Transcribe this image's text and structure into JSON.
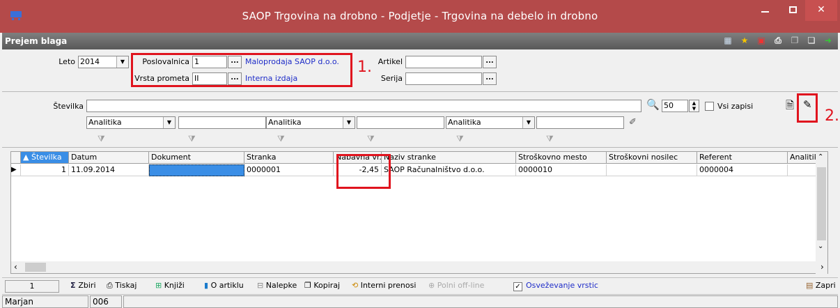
{
  "window": {
    "title": "SAOP Trgovina na drobno - Podjetje - Trgovina na debelo in drobno",
    "minimize": "—",
    "close": "✕"
  },
  "form": {
    "title": "Prejem blaga"
  },
  "filters": {
    "leto_label": "Leto",
    "leto_value": "2014",
    "poslovalnica_label": "Poslovalnica",
    "poslovalnica_value": "1",
    "poslovalnica_name": "Maloprodaja SAOP d.o.o.",
    "vrsta_label": "Vrsta prometa",
    "vrsta_value": "II",
    "vrsta_name": "Interna izdaja",
    "artikel_label": "Artikel",
    "serija_label": "Serija",
    "annotation_1": "1.",
    "annotation_2": "2.",
    "stevilka_label": "Številka",
    "count_value": "50",
    "vsi_zapisi": "Vsi zapisi",
    "analitika_1": "Analitika",
    "analitika_2": "Analitika",
    "analitika_3": "Analitika"
  },
  "grid": {
    "columns": [
      "Številka",
      "Datum",
      "Dokument",
      "Stranka",
      "Nabavna vr.",
      "Naziv stranke",
      "Stroškovno mesto",
      "Stroškovni nosilec",
      "Referent",
      "Analitika"
    ],
    "rows": [
      [
        "1",
        "11.09.2014",
        "",
        "0000001",
        "-2,45",
        "SAOP Računalništvo d.o.o.",
        "0000010",
        "",
        "0000004",
        ""
      ]
    ]
  },
  "bottom": {
    "row_count": "1",
    "zbiri": "Zbiri",
    "tiskaj": "Tiskaj",
    "knjizi": "Knjiži",
    "o_artiklu": "O artiklu",
    "nalepke": "Nalepke",
    "kopiraj": "Kopiraj",
    "interni_prenosi": "Interni prenosi",
    "polni_offline": "Polni off-line",
    "osvezevanje": "Osveževanje vrstic",
    "zapri": "Zapri"
  },
  "status": {
    "user": "Marjan",
    "code": "006"
  }
}
